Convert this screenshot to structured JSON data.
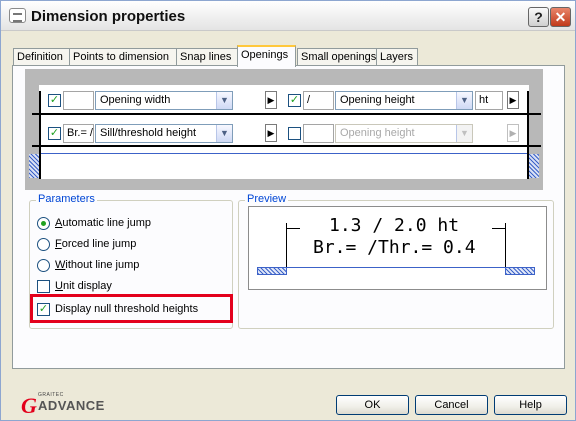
{
  "window": {
    "title": "Dimension properties",
    "help_glyph": "?",
    "close_glyph": "✕"
  },
  "tabs": [
    {
      "label": "Definition"
    },
    {
      "label": "Points to dimension"
    },
    {
      "label": "Snap lines"
    },
    {
      "label": "Openings",
      "active": true
    },
    {
      "label": "Small openings"
    },
    {
      "label": "Layers"
    }
  ],
  "openings_rows": {
    "row1": {
      "left_checked": true,
      "left_prefix": "",
      "left_combo": "Opening width",
      "right_checked": true,
      "right_prefix": "/",
      "right_combo": "Opening height",
      "right_suffix": "ht"
    },
    "row2": {
      "left_checked": true,
      "left_prefix": "Br.= /",
      "left_combo": "Sill/threshold height",
      "right_checked": false,
      "right_prefix": "",
      "right_combo": "Opening height",
      "right_combo_disabled": true
    }
  },
  "parameters": {
    "title": "Parameters",
    "options": [
      {
        "label": "Automatic line jump",
        "mnemonic": "A",
        "rest": "utomatic line jump",
        "selected": true
      },
      {
        "label": "Forced line jump",
        "mnemonic": "F",
        "rest": "orced line jump",
        "selected": false
      },
      {
        "label": "Without line jump",
        "mnemonic": "W",
        "rest": "ithout line jump",
        "selected": false
      }
    ],
    "unit_display": {
      "mnemonic": "U",
      "rest": "nit display",
      "checked": false
    },
    "null_threshold": {
      "label": "Display null threshold heights",
      "checked": true
    }
  },
  "preview": {
    "title": "Preview",
    "line1": "1.3 / 2.0 ht",
    "line2": "Br.= /Thr.= 0.4"
  },
  "logo": {
    "small": "GRAITEC",
    "word": "ADVANCE",
    "letter": "G"
  },
  "buttons": {
    "ok": "OK",
    "cancel": "Cancel",
    "help": "Help"
  },
  "colors": {
    "highlight": "#e3001b",
    "group_title": "#0046d5",
    "check_green": "#21a121"
  }
}
